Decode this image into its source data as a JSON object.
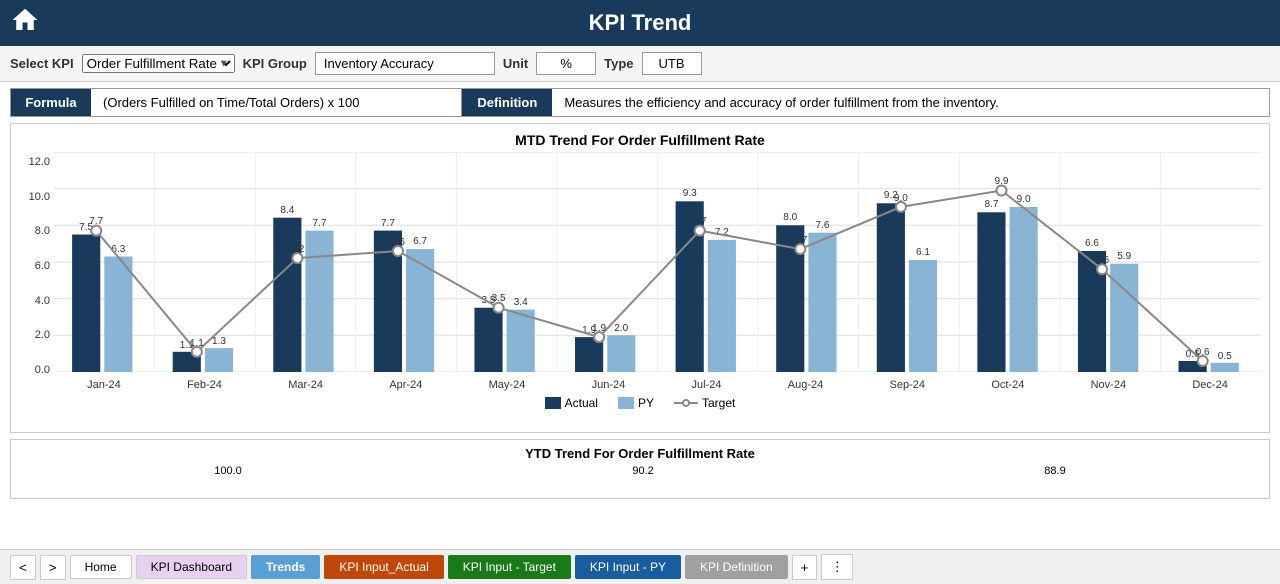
{
  "header": {
    "title": "KPI Trend"
  },
  "controls": {
    "select_kpi_label": "Select KPI",
    "kpi_value": "Order Fulfillment Rate",
    "kpi_group_label": "KPI Group",
    "kpi_group_value": "Inventory Accuracy",
    "unit_label": "Unit",
    "unit_value": "%",
    "type_label": "Type",
    "type_value": "UTB"
  },
  "formula": {
    "label": "Formula",
    "content": "(Orders Fulfilled on Time/Total Orders) x 100"
  },
  "definition": {
    "label": "Definition",
    "content": "Measures the efficiency and accuracy of order fulfillment from the inventory."
  },
  "mtd_chart": {
    "title": "MTD Trend For Order Fulfillment Rate",
    "y_labels": [
      "12.0",
      "10.0",
      "8.0",
      "6.0",
      "4.0",
      "2.0",
      "0.0"
    ],
    "months": [
      "Jan-24",
      "Feb-24",
      "Mar-24",
      "Apr-24",
      "May-24",
      "Jun-24",
      "Jul-24",
      "Aug-24",
      "Sep-24",
      "Oct-24",
      "Nov-24",
      "Dec-24"
    ],
    "actual": [
      7.5,
      1.1,
      8.4,
      7.7,
      3.5,
      1.9,
      9.3,
      8.0,
      9.2,
      8.7,
      6.6,
      0.6
    ],
    "py": [
      6.3,
      1.3,
      7.7,
      6.7,
      3.4,
      2.0,
      7.2,
      7.6,
      6.1,
      9.0,
      5.9,
      0.5
    ],
    "target": [
      7.7,
      1.1,
      6.2,
      6.6,
      3.5,
      1.9,
      7.7,
      6.7,
      9.0,
      9.9,
      5.6,
      0.6
    ],
    "legend": {
      "actual": "Actual",
      "py": "PY",
      "target": "Target"
    }
  },
  "ytd_chart": {
    "title": "YTD Trend For Order Fulfillment Rate",
    "y_start": "100.0",
    "values": [
      "90.2",
      "88.9"
    ]
  },
  "bottom_tabs": {
    "nav_prev": "<",
    "nav_next": ">",
    "home": "Home",
    "dashboard": "KPI Dashboard",
    "trends": "Trends",
    "actual": "KPI Input_Actual",
    "target": "KPI Input - Target",
    "py": "KPI Input - PY",
    "definition": "KPI Definition",
    "add": "+",
    "more": "⋮"
  }
}
